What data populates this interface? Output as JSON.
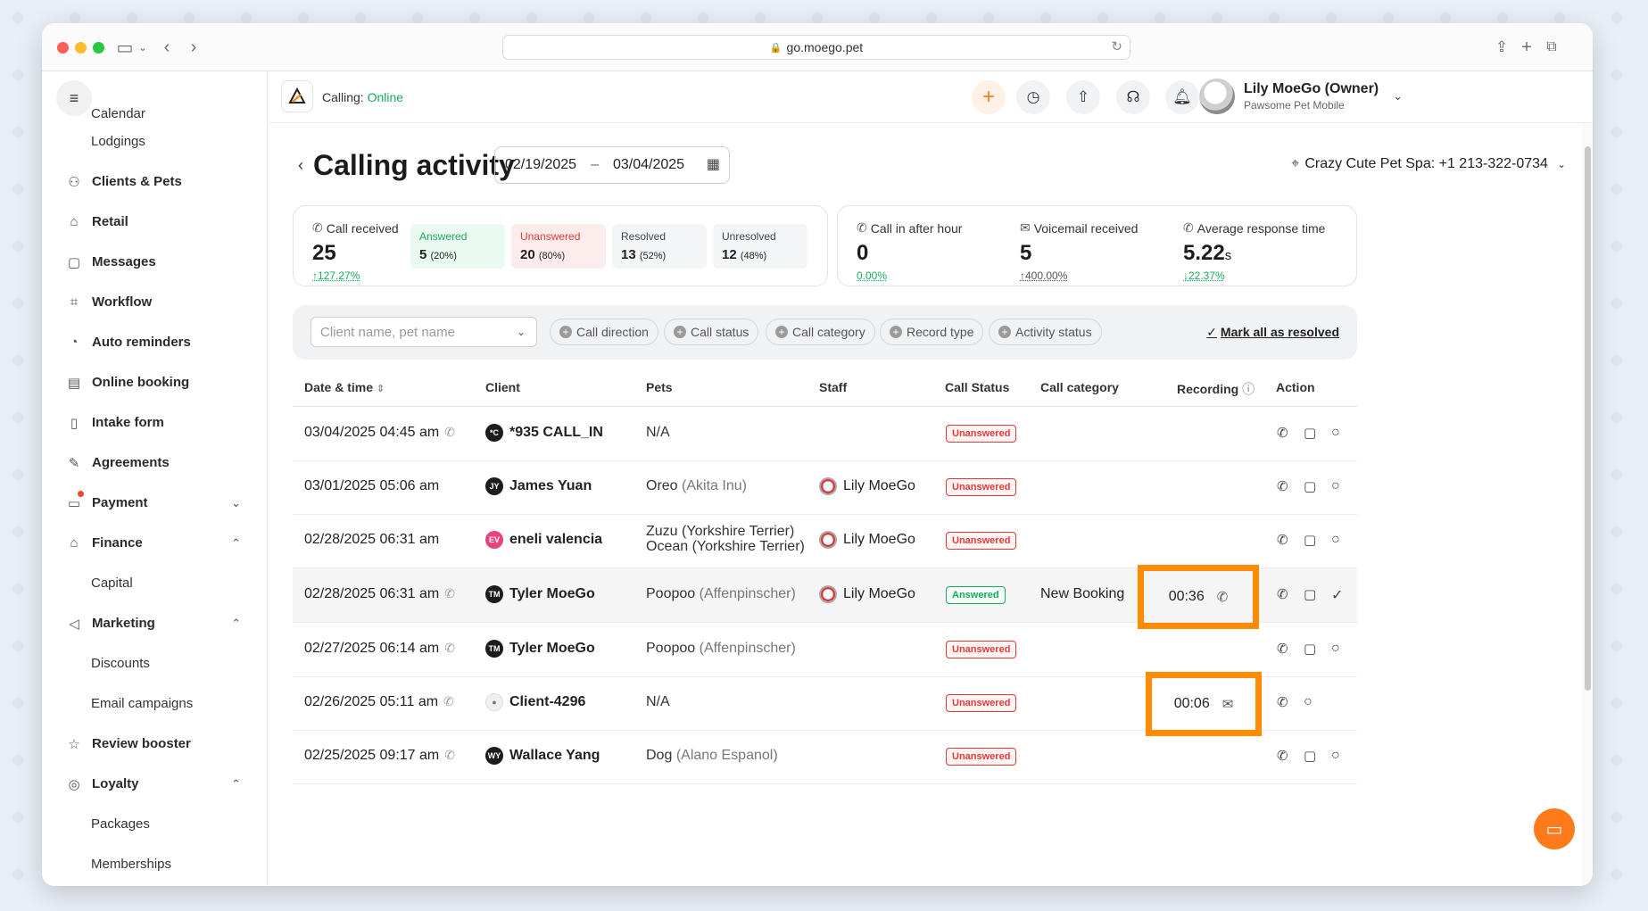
{
  "browser": {
    "url": "go.moego.pet"
  },
  "sidebar": {
    "items": [
      {
        "label": "Calendar",
        "icon": "calendar-icon",
        "sub": true
      },
      {
        "label": "Lodgings",
        "icon": "",
        "sub": true
      },
      {
        "label": "Clients & Pets",
        "icon": "user-group-icon"
      },
      {
        "label": "Retail",
        "icon": "bag-icon"
      },
      {
        "label": "Messages",
        "icon": "message-icon"
      },
      {
        "label": "Workflow",
        "icon": "workflow-icon"
      },
      {
        "label": "Auto reminders",
        "icon": "alarm-icon"
      },
      {
        "label": "Online booking",
        "icon": "booking-icon"
      },
      {
        "label": "Intake form",
        "icon": "clipboard-icon"
      },
      {
        "label": "Agreements",
        "icon": "pen-icon"
      },
      {
        "label": "Payment",
        "icon": "payment-icon"
      },
      {
        "label": "Finance",
        "icon": "bank-icon"
      },
      {
        "label": "Capital",
        "sub": true
      },
      {
        "label": "Marketing",
        "icon": "megaphone-icon"
      },
      {
        "label": "Discounts",
        "sub": true
      },
      {
        "label": "Email campaigns",
        "sub": true
      },
      {
        "label": "Review booster",
        "icon": "review-icon"
      },
      {
        "label": "Loyalty",
        "icon": "loyalty-icon"
      },
      {
        "label": "Packages",
        "sub": true
      },
      {
        "label": "Memberships",
        "sub": true
      }
    ]
  },
  "topbar": {
    "calling_label": "Calling:",
    "calling_status": "Online",
    "user_name": "Lily MoeGo (Owner)",
    "business": "Pawsome Pet Mobile"
  },
  "page": {
    "title": "Calling activity",
    "date_from": "02/19/2025",
    "date_to": "03/04/2025",
    "date_sep": "–",
    "location": "Crazy Cute Pet Spa: +1 213-322-0734"
  },
  "stats": {
    "call_received": {
      "label": "Call received",
      "value": "25",
      "change": "↑127.27%"
    },
    "answered": {
      "label": "Answered",
      "value": "5",
      "pct": "(20%)"
    },
    "unanswered": {
      "label": "Unanswered",
      "value": "20",
      "pct": "(80%)"
    },
    "resolved": {
      "label": "Resolved",
      "value": "13",
      "pct": "(52%)"
    },
    "unresolved": {
      "label": "Unresolved",
      "value": "12",
      "pct": "(48%)"
    },
    "after_hour": {
      "label": "Call in after hour",
      "value": "0",
      "change": "0.00%"
    },
    "voicemail": {
      "label": "Voicemail received",
      "value": "5",
      "change": "↑400.00%"
    },
    "avg_response": {
      "label": "Average response time",
      "value": "5.22",
      "unit": "s",
      "change": "↓22.37%"
    }
  },
  "filters": {
    "search_placeholder": "Client name, pet name",
    "chips": [
      "Call direction",
      "Call status",
      "Call category",
      "Record type",
      "Activity status"
    ],
    "mark_all": "Mark all as resolved"
  },
  "table": {
    "headers": [
      "Date & time",
      "Client",
      "Pets",
      "Staff",
      "Call Status",
      "Call category",
      "Recording",
      "Action"
    ],
    "rows": [
      {
        "dt": "03/04/2025 04:45 am",
        "initials": "*C",
        "client": "*935 CALL_IN",
        "pet": "N/A",
        "breed": "",
        "staff": "",
        "status": "Unanswered",
        "category": "",
        "recording": ""
      },
      {
        "dt": "03/01/2025 05:06 am",
        "initials": "JY",
        "client": "James Yuan",
        "pet": "Oreo",
        "breed": "(Akita Inu)",
        "staff": "Lily MoeGo",
        "status": "Unanswered",
        "category": "",
        "recording": ""
      },
      {
        "dt": "02/28/2025 06:31 am",
        "initials": "EV",
        "client": "eneli valencia",
        "pet": "Zuzu",
        "breed": "(Yorkshire Terrier)",
        "pet2": "Ocean",
        "breed2": "(Yorkshire Terrier)",
        "staff": "Lily MoeGo",
        "status": "Unanswered",
        "category": "",
        "recording": ""
      },
      {
        "dt": "02/28/2025 06:31 am",
        "initials": "TM",
        "client": "Tyler MoeGo",
        "pet": "Poopoo",
        "breed": "(Affenpinscher)",
        "staff": "Lily MoeGo",
        "status": "Answered",
        "category": "New Booking",
        "recording": "00:36"
      },
      {
        "dt": "02/27/2025 06:14 am",
        "initials": "TM",
        "client": "Tyler MoeGo",
        "pet": "Poopoo",
        "breed": "(Affenpinscher)",
        "staff": "",
        "status": "Unanswered",
        "category": "",
        "recording": ""
      },
      {
        "dt": "02/26/2025 05:11 am",
        "initials": "",
        "client": "Client-4296",
        "pet": "N/A",
        "breed": "",
        "staff": "",
        "status": "Unanswered",
        "category": "",
        "recording": "00:06"
      },
      {
        "dt": "02/25/2025 09:17 am",
        "initials": "WY",
        "client": "Wallace Yang",
        "pet": "Dog",
        "breed": "(Alano Espanol)",
        "staff": "",
        "status": "Unanswered",
        "category": "",
        "recording": ""
      }
    ]
  },
  "colors": {
    "accent": "#ff8c00",
    "online": "#1aab5c",
    "unanswered": "#e53935"
  }
}
